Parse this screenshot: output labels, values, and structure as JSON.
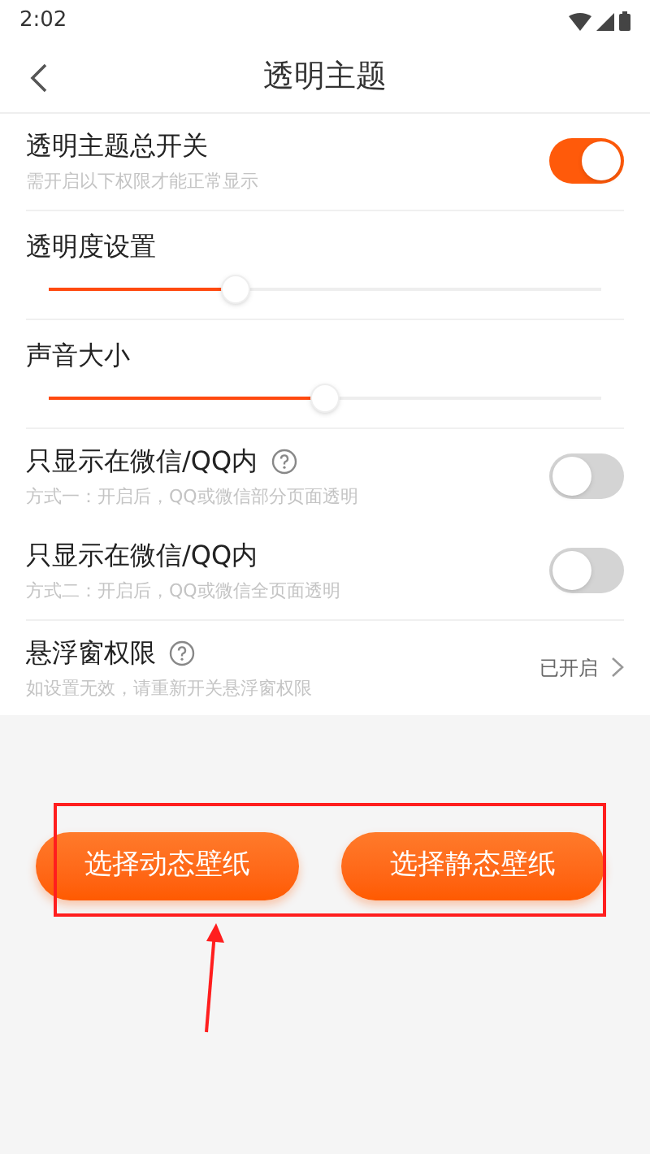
{
  "status_bar": {
    "time": "2:02"
  },
  "header": {
    "title": "透明主题"
  },
  "settings": [
    {
      "kind": "toggle",
      "label": "透明主题总开关",
      "subtitle": "需开启以下权限才能正常显示",
      "help": false,
      "on": true
    },
    {
      "kind": "slider",
      "label": "透明度设置",
      "level": 0.33
    },
    {
      "kind": "slider",
      "label": "声音大小",
      "level": 0.5
    },
    {
      "kind": "toggle",
      "label": "只显示在微信/QQ内",
      "subtitle": "方式一：开启后，QQ或微信部分页面透明",
      "help": true,
      "on": false
    },
    {
      "kind": "toggle",
      "label": "只显示在微信/QQ内",
      "subtitle": "方式二：开启后，QQ或微信全页面透明",
      "help": false,
      "on": false
    },
    {
      "kind": "link",
      "label": "悬浮窗权限",
      "subtitle": "如设置无效，请重新开关悬浮窗权限",
      "help": true,
      "value": "已开启"
    }
  ],
  "buttons": [
    "选择动态壁纸",
    "选择静态壁纸"
  ]
}
